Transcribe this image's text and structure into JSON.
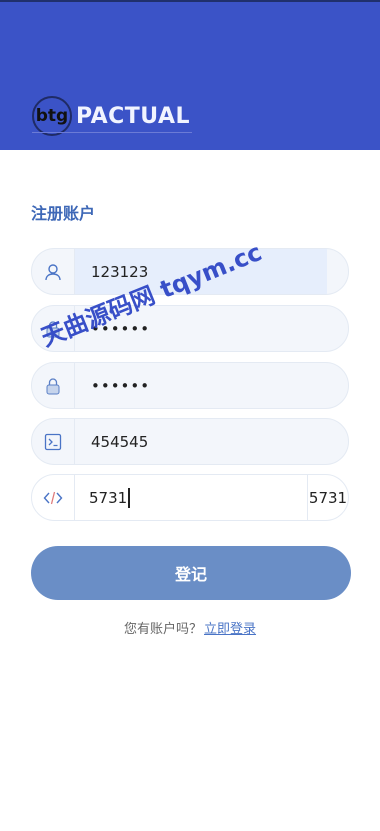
{
  "brand": {
    "mark": "btg",
    "name": "PACTUAL"
  },
  "page_title": "注册账户",
  "fields": {
    "username": {
      "value": "123123",
      "icon": "user-icon"
    },
    "password": {
      "value": "••••••",
      "icon": "lock-icon"
    },
    "confirm_password": {
      "value": "••••••",
      "icon": "lock-icon"
    },
    "invite_code": {
      "value": "454545",
      "icon": "terminal-icon"
    },
    "captcha": {
      "value": "5731",
      "code": "5731",
      "icon": "code-icon"
    }
  },
  "submit_label": "登记",
  "footer": {
    "prompt": "您有账户吗？",
    "login_link": "立即登录"
  },
  "watermark": "天曲源码网 tqym.cc",
  "colors": {
    "header": "#3b53c7",
    "accent": "#3e68b7",
    "button": "#6a8ec6"
  }
}
